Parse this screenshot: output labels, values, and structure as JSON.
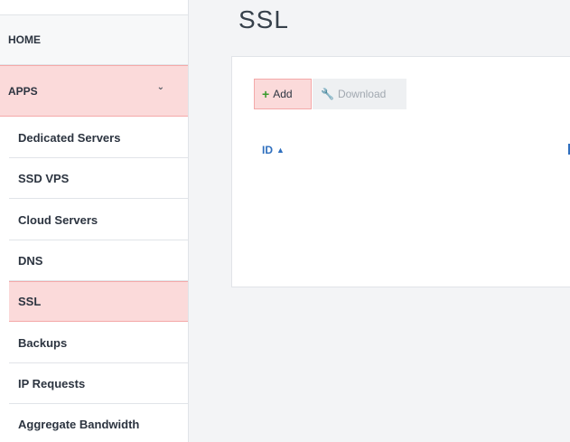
{
  "page": {
    "title": "SSL"
  },
  "sidebar": {
    "home_label": "HOME",
    "apps_label": "APPS",
    "apps_chevron": "chevron-down-icon",
    "items": [
      {
        "label": "Dedicated Servers",
        "active": false
      },
      {
        "label": "SSD VPS",
        "active": false
      },
      {
        "label": "Cloud Servers",
        "active": false
      },
      {
        "label": "DNS",
        "active": false
      },
      {
        "label": "SSL",
        "active": true
      },
      {
        "label": "Backups",
        "active": false
      },
      {
        "label": "IP Requests",
        "active": false
      },
      {
        "label": "Aggregate Bandwidth",
        "active": false
      }
    ]
  },
  "toolbar": {
    "add_label": "Add",
    "add_icon": "plus-icon",
    "download_label": "Download",
    "download_icon": "wrench-icon"
  },
  "table": {
    "columns": [
      {
        "label": "ID",
        "sort": "ascending"
      }
    ]
  },
  "colors": {
    "active_bg": "#fbdada",
    "active_border": "#f4a9a9",
    "link_blue": "#2f6fbe",
    "add_plus_green": "#3a9b2e"
  }
}
